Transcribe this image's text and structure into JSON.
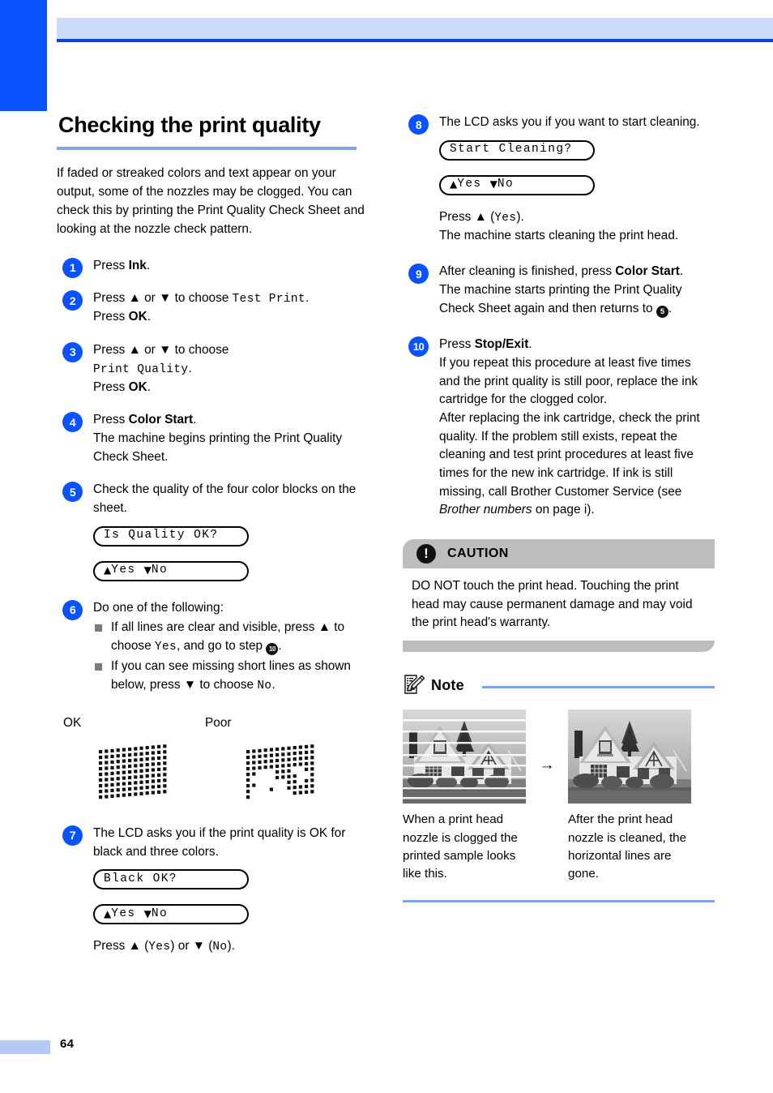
{
  "page": {
    "number": "64",
    "accent_blue": "#0a52ff",
    "header_band": "#cbd9fb",
    "rule_blue": "#7da5e8",
    "caution_gray": "#bdbdbd"
  },
  "left": {
    "title": "Checking the print quality",
    "intro": "If faded or streaked colors and text appear on your output, some of the nozzles may be clogged. You can check this by printing the Print Quality Check Sheet and looking at the nozzle check pattern.",
    "steps": [
      {
        "num": "1",
        "line1_a": "Press ",
        "line1_bold": "Ink",
        "line1_b": "."
      },
      {
        "num": "2",
        "l1": "Press ▲ or ▼ to choose ",
        "mono1": "Test Print",
        "l1b": ".",
        "l2a": "Press ",
        "l2bold": "OK",
        "l2b": "."
      },
      {
        "num": "3",
        "l1": "Press ▲ or ▼ to choose",
        "mono1": "Print Quality",
        "mono1_end": ".",
        "l2a": "Press ",
        "l2bold": "OK",
        "l2b": "."
      },
      {
        "num": "4",
        "l1a": "Press ",
        "l1bold": "Color Start",
        "l1b": ".",
        "l2": "The machine begins printing the Print Quality Check Sheet."
      },
      {
        "num": "5",
        "l1": "Check the quality of the four color blocks on the sheet.",
        "lcd1": "Is Quality OK?",
        "lcd2_yes": "Yes",
        "lcd2_no": "No"
      },
      {
        "num": "6",
        "l1": "Do one of the following:",
        "b1_a": "If all lines are clear and visible, press ▲ to choose ",
        "b1_mono": "Yes",
        "b1_b": ", and go to step ",
        "b1_ref": "10",
        "b1_c": ".",
        "b2_a": "If you can see missing short lines as shown below, press ▼ to choose ",
        "b2_mono": "No",
        "b2_b": "."
      },
      {
        "num": "7",
        "l1": "The LCD asks you if the print quality is OK for black and three colors.",
        "lcd1": "Black OK?",
        "lcd2_yes": "Yes",
        "lcd2_no": "No",
        "after_a": "Press ▲ (",
        "after_m1": "Yes",
        "after_b": ") or ▼ (",
        "after_m2": "No",
        "after_c": ")."
      }
    ],
    "pattern": {
      "label_ok": "OK",
      "label_poor": "Poor"
    }
  },
  "right": {
    "steps": [
      {
        "num": "8",
        "l1": "The LCD asks you if you want to start cleaning.",
        "lcd1": "Start Cleaning?",
        "lcd2_yes": "Yes",
        "lcd2_no": "No",
        "after_a": "Press ▲ (",
        "after_m": "Yes",
        "after_b": ").",
        "after_l2": "The machine starts cleaning the print head."
      },
      {
        "num": "9",
        "l1a": "After cleaning is finished, press ",
        "l1bold": "Color Start",
        "l1b": ".",
        "l2": "The machine starts printing the Print Quality Check Sheet again and then returns to ",
        "l2_ref": "5",
        "l2_end": "."
      },
      {
        "num": "10",
        "l1a": "Press ",
        "l1bold": "Stop/Exit",
        "l1b": ".",
        "l2": "If you repeat this procedure at least five times and the print quality is still poor, replace the ink cartridge for the clogged color.",
        "l3a": "After replacing the ink cartridge, check the print quality. If the problem still exists, repeat the cleaning and test print procedures at least five times for the new ink cartridge. If ink is still missing, call Brother Customer Service (see ",
        "l3_ital": "Brother numbers",
        "l3b": " on page i)."
      }
    ],
    "caution": {
      "icon": "exclamation-icon",
      "title": "CAUTION",
      "body": "DO NOT touch the print head. Touching the print head may cause permanent damage and may void the print head's warranty."
    },
    "note": {
      "icon": "note-pencil-icon",
      "title": "Note",
      "figure_left_caption": "When a print head nozzle is clogged the printed sample looks like this.",
      "figure_right_caption": "After the print head nozzle is cleaned, the horizontal lines are gone.",
      "arrow": "→"
    }
  }
}
